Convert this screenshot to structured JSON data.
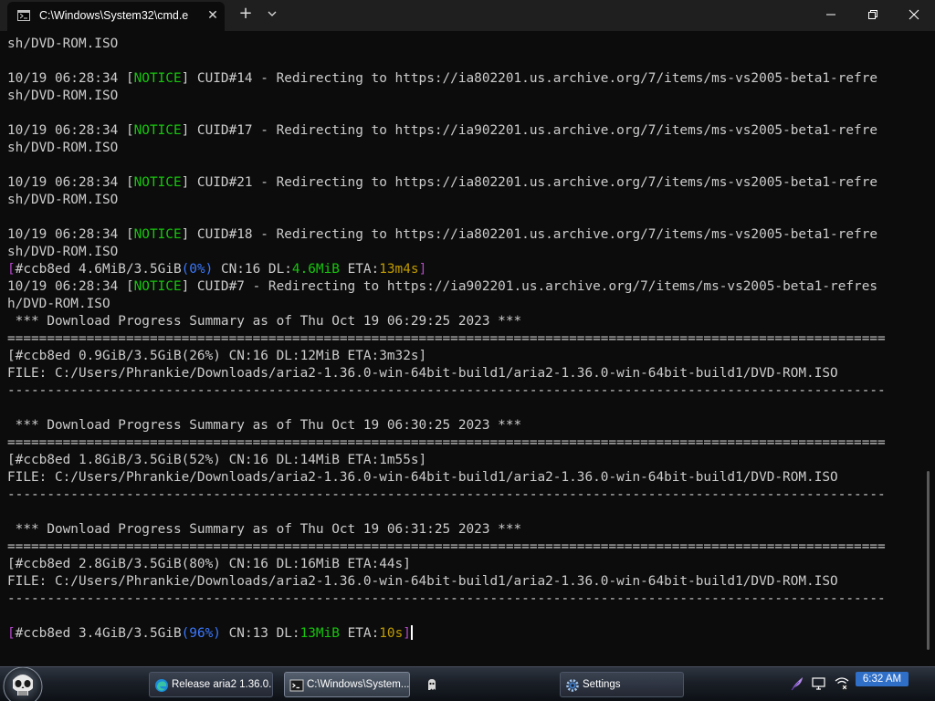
{
  "window": {
    "tab_title": "C:\\Windows\\System32\\cmd.e",
    "tab_close_glyph": "✕",
    "new_tab_glyph": "+",
    "icons": {
      "tab": "cmd-icon",
      "dropdown": "chevron-down-icon",
      "minimize": "minimize-icon",
      "maximize": "maximize-icon",
      "close": "close-icon"
    }
  },
  "console": {
    "colors": {
      "background": "#0c0c0c",
      "text": "#cccccc",
      "notice": "#16c60c",
      "bracket": "#b148c6",
      "percent": "#3b78ff",
      "speed": "#16c60c",
      "eta": "#c19c00"
    },
    "lines": [
      {
        "segs": [
          {
            "t": "sh/DVD-ROM.ISO"
          }
        ]
      },
      {
        "segs": [
          {
            "t": ""
          }
        ]
      },
      {
        "segs": [
          {
            "t": "10/19 06:28:34 ["
          },
          {
            "t": "NOTICE",
            "c": "notice"
          },
          {
            "t": "] CUID#14 - Redirecting to https://ia802201.us.archive.org/7/items/ms-vs2005-beta1-refre"
          }
        ]
      },
      {
        "segs": [
          {
            "t": "sh/DVD-ROM.ISO"
          }
        ]
      },
      {
        "segs": [
          {
            "t": ""
          }
        ]
      },
      {
        "segs": [
          {
            "t": "10/19 06:28:34 ["
          },
          {
            "t": "NOTICE",
            "c": "notice"
          },
          {
            "t": "] CUID#17 - Redirecting to https://ia902201.us.archive.org/7/items/ms-vs2005-beta1-refre"
          }
        ]
      },
      {
        "segs": [
          {
            "t": "sh/DVD-ROM.ISO"
          }
        ]
      },
      {
        "segs": [
          {
            "t": ""
          }
        ]
      },
      {
        "segs": [
          {
            "t": "10/19 06:28:34 ["
          },
          {
            "t": "NOTICE",
            "c": "notice"
          },
          {
            "t": "] CUID#21 - Redirecting to https://ia802201.us.archive.org/7/items/ms-vs2005-beta1-refre"
          }
        ]
      },
      {
        "segs": [
          {
            "t": "sh/DVD-ROM.ISO"
          }
        ]
      },
      {
        "segs": [
          {
            "t": ""
          }
        ]
      },
      {
        "segs": [
          {
            "t": "10/19 06:28:34 ["
          },
          {
            "t": "NOTICE",
            "c": "notice"
          },
          {
            "t": "] CUID#18 - Redirecting to https://ia802201.us.archive.org/7/items/ms-vs2005-beta1-refre"
          }
        ]
      },
      {
        "segs": [
          {
            "t": "sh/DVD-ROM.ISO"
          }
        ]
      },
      {
        "segs": [
          {
            "t": "[",
            "c": "purple"
          },
          {
            "t": "#ccb8ed 4.6MiB/3.5GiB"
          },
          {
            "t": "(0%)",
            "c": "blue"
          },
          {
            "t": " CN:16 DL:"
          },
          {
            "t": "4.6MiB",
            "c": "green"
          },
          {
            "t": " ETA:"
          },
          {
            "t": "13m4s",
            "c": "yellow"
          },
          {
            "t": "]",
            "c": "purple"
          }
        ]
      },
      {
        "segs": [
          {
            "t": "10/19 06:28:34 ["
          },
          {
            "t": "NOTICE",
            "c": "notice"
          },
          {
            "t": "] CUID#7 - Redirecting to https://ia902201.us.archive.org/7/items/ms-vs2005-beta1-refres"
          }
        ]
      },
      {
        "segs": [
          {
            "t": "h/DVD-ROM.ISO"
          }
        ]
      },
      {
        "segs": [
          {
            "t": " *** Download Progress Summary as of Thu Oct 19 06:29:25 2023 ***"
          }
        ]
      },
      {
        "segs": [
          {
            "t": "==============================================================================================================="
          }
        ]
      },
      {
        "segs": [
          {
            "t": "[#ccb8ed 0.9GiB/3.5GiB(26%) CN:16 DL:12MiB ETA:3m32s]"
          }
        ]
      },
      {
        "segs": [
          {
            "t": "FILE: C:/Users/Phrankie/Downloads/aria2-1.36.0-win-64bit-build1/aria2-1.36.0-win-64bit-build1/DVD-ROM.ISO"
          }
        ]
      },
      {
        "segs": [
          {
            "t": "---------------------------------------------------------------------------------------------------------------"
          }
        ]
      },
      {
        "segs": [
          {
            "t": ""
          }
        ]
      },
      {
        "segs": [
          {
            "t": " *** Download Progress Summary as of Thu Oct 19 06:30:25 2023 ***"
          }
        ]
      },
      {
        "segs": [
          {
            "t": "==============================================================================================================="
          }
        ]
      },
      {
        "segs": [
          {
            "t": "[#ccb8ed 1.8GiB/3.5GiB(52%) CN:16 DL:14MiB ETA:1m55s]"
          }
        ]
      },
      {
        "segs": [
          {
            "t": "FILE: C:/Users/Phrankie/Downloads/aria2-1.36.0-win-64bit-build1/aria2-1.36.0-win-64bit-build1/DVD-ROM.ISO"
          }
        ]
      },
      {
        "segs": [
          {
            "t": "---------------------------------------------------------------------------------------------------------------"
          }
        ]
      },
      {
        "segs": [
          {
            "t": ""
          }
        ]
      },
      {
        "segs": [
          {
            "t": " *** Download Progress Summary as of Thu Oct 19 06:31:25 2023 ***"
          }
        ]
      },
      {
        "segs": [
          {
            "t": "==============================================================================================================="
          }
        ]
      },
      {
        "segs": [
          {
            "t": "[#ccb8ed 2.8GiB/3.5GiB(80%) CN:16 DL:16MiB ETA:44s]"
          }
        ]
      },
      {
        "segs": [
          {
            "t": "FILE: C:/Users/Phrankie/Downloads/aria2-1.36.0-win-64bit-build1/aria2-1.36.0-win-64bit-build1/DVD-ROM.ISO"
          }
        ]
      },
      {
        "segs": [
          {
            "t": "---------------------------------------------------------------------------------------------------------------"
          }
        ]
      },
      {
        "segs": [
          {
            "t": ""
          }
        ]
      },
      {
        "segs": [
          {
            "t": "[",
            "c": "purple"
          },
          {
            "t": "#ccb8ed 3.4GiB/3.5GiB"
          },
          {
            "t": "(96%)",
            "c": "blue"
          },
          {
            "t": " CN:13 DL:"
          },
          {
            "t": "13MiB",
            "c": "green"
          },
          {
            "t": " ETA:"
          },
          {
            "t": "10s",
            "c": "yellow"
          },
          {
            "t": "]",
            "c": "purple"
          }
        ],
        "cursor": true
      }
    ]
  },
  "taskbar": {
    "start_icon": "skull-orb-icon",
    "buttons": [
      {
        "label": "Release aria2 1.36.0...",
        "icon": "edge-browser-icon"
      },
      {
        "label": "C:\\Windows\\System...",
        "icon": "terminal-icon"
      },
      {
        "label": "",
        "icon": "ghost-app-icon"
      },
      {
        "label": "Settings",
        "icon": "gear-icon"
      }
    ],
    "tray_icons": [
      "feather-icon",
      "display-icon",
      "network-icon"
    ],
    "clock": "6:32 AM"
  }
}
